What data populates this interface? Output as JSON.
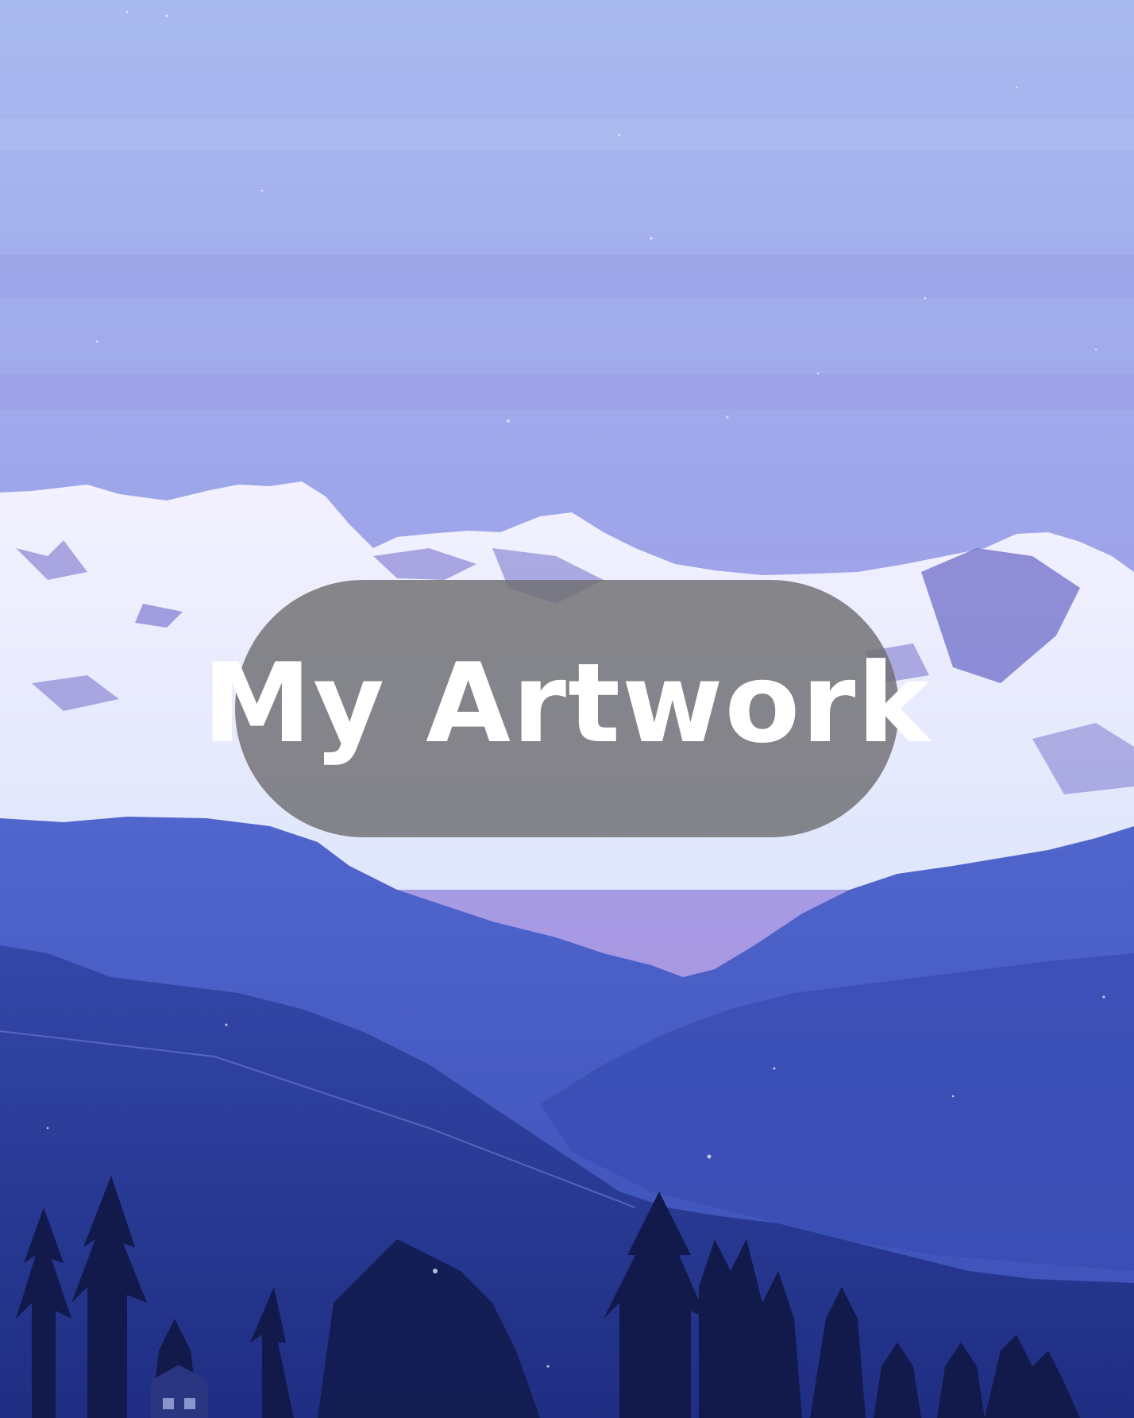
{
  "title": "My Artwork",
  "colors": {
    "sky_top": "#a8b8ee",
    "sky_mid": "#9c9ae6",
    "sky_low": "#b19ae0",
    "snow": "#eef0ff",
    "snow_shadow": "#7e7cd0",
    "near_ridge": "#4759c4",
    "valley": "#3c50b8",
    "foreground": "#22348a",
    "trees": "#0e1640",
    "pill": "#6e6e70",
    "title_text": "#ffffff"
  },
  "icons": [
    "mountain-landscape-background"
  ]
}
